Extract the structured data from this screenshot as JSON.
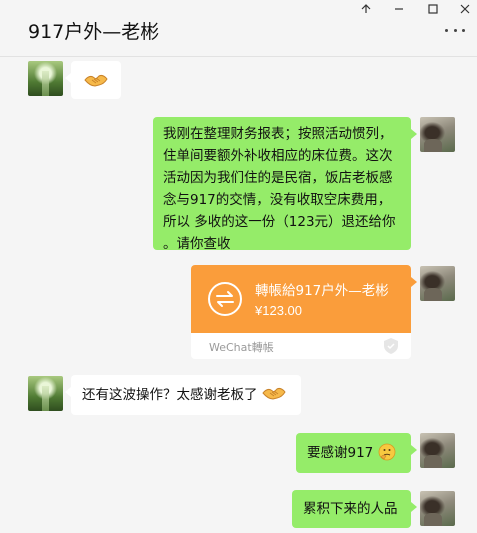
{
  "window": {
    "title": "917户外—老彬",
    "controls": {
      "pin": "⊼",
      "minimize": "—",
      "maximize": "☐",
      "close": "✕"
    }
  },
  "messages": [
    {
      "side": "left",
      "type": "emoji",
      "emoji": "handshake"
    },
    {
      "side": "right",
      "type": "text",
      "lines": [
        "我刚在整理财务报表；按照活动惯列，",
        "住单间要额外补收相应的床位费。这次",
        "活动因为我们住的是民宿，饭店老板感",
        "念与917的交情，没有收取空床费用，",
        "所以 多收的这一份（123元）退还给你",
        "。请你查收"
      ]
    },
    {
      "side": "right",
      "type": "transfer",
      "title": "轉帳給917户外—老彬",
      "amount": "¥123.00",
      "footer": "WeChat轉帳"
    },
    {
      "side": "left",
      "type": "text",
      "text": "还有这波操作？太感谢老板了",
      "emoji": "handshake"
    },
    {
      "side": "right",
      "type": "text",
      "text": "要感谢917",
      "emoji": "thinking-face"
    },
    {
      "side": "right",
      "type": "text",
      "text": "累积下来的人品"
    }
  ],
  "colors": {
    "green_bubble": "#95ec69",
    "white_bubble": "#ffffff",
    "transfer_orange": "#fa9d3b",
    "background": "#f5f5f5"
  }
}
